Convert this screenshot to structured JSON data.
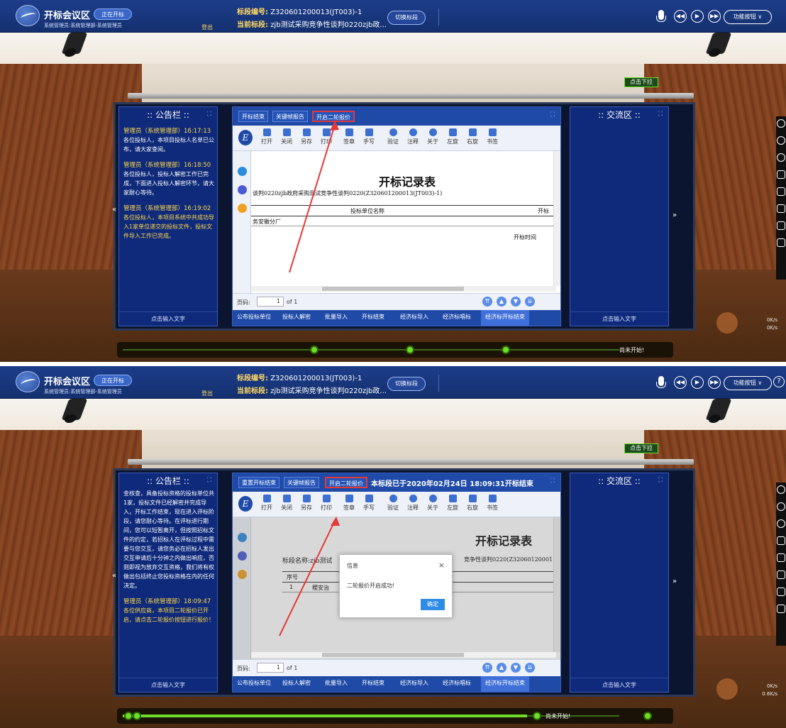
{
  "header": {
    "title": "开标会议区",
    "badge": "正在开标",
    "user": "系统管理员:系统管理部-系统管理员",
    "logout": "登出",
    "bid_no_label": "标段编号:",
    "bid_no": "Z320601200013(JT003)-1",
    "current_label": "当前标段:",
    "current_value": "zjb测试采购竞争性谈判0220zjb政...",
    "switch_btn": "切换标段",
    "prev": "◀◀",
    "play": "▶",
    "next": "▶▶",
    "func_btn": "功能按钮 ∨",
    "help": "?"
  },
  "stage": {
    "drop_btn": "点击下拉",
    "side_left": "«",
    "side_right": "»"
  },
  "left_panel": {
    "title": ":: 公告栏 ::",
    "expand": "⛶",
    "input_hint": "点击输入文字"
  },
  "right_panel": {
    "title": ":: 交流区 ::",
    "expand": "⛶",
    "input_hint": "点击输入文字"
  },
  "shot1": {
    "tabs": [
      "开标结束",
      "关键帧报告",
      "开启二轮报价"
    ],
    "notices": [
      {
        "head": "管理员（系统管理部）16:17:13",
        "body": "各位投标人，本项目投标人名单已公布，请大家查阅。"
      },
      {
        "head": "管理员（系统管理部）16:18:50",
        "body": "各位投标人，投标人解密工作已完成，下面进入投标人解密环节，请大家耐心等待。"
      },
      {
        "head": "管理员（系统管理部）16:19:02",
        "body": "各位投标人，本项目系统中共成功导入1家单位递交的投标文件，投标文件导入工作已完成。"
      }
    ],
    "doc": {
      "title": "开标记录表",
      "line": "谈判0220zjb政府采购测试竞争性谈判0220(Z320601200013(JT003)-1)",
      "col_name": "投标单位名称",
      "col_right": "开标",
      "row_name": "务安徽分厂",
      "row_right": "开标时间"
    },
    "progress": {
      "status": "尚未开始!",
      "fill_fraction": 0.0
    }
  },
  "shot2": {
    "tabs": [
      "重置开标结束",
      "关键帧报告",
      "开启二轮报价"
    ],
    "notice_banner": "本标段已于2020年02月24日 18:09:31开标结束",
    "notices": [
      {
        "head": "",
        "body": "金核查，具备投标资格的投标单位共1家，投标文件已经解密并完成导入，开标工作结束，现在进入评标阶段，请您耐心等待。在评标进行期间，您可以短暂离开，但按照招标文件的约定，若招标人在评标过程中需要与您交互，请您务必在招标人发出交互申请后十分钟之内做出响应，否则即视为放弃交互资格，我们将有权做出包括终止您投标资格在内的任何决定。"
      },
      {
        "head": "管理员（系统管理部）18:09:47",
        "body": "各位供应商，本项目二轮报价已开启，请点击二轮报价按钮进行报价！"
      }
    ],
    "doc": {
      "title": "开标记录表",
      "line_left": "标段名称:zjb测试",
      "line_right": "竞争性谈判0220(Z32060120001",
      "col_no": "序号",
      "row_no": "1",
      "row_name": "稷安治"
    },
    "modal": {
      "title": "信息",
      "close": "×",
      "message": "二轮报价开启成功!",
      "ok": "确定"
    },
    "progress": {
      "status": "尚未开始!",
      "fill_fraction": 0.75
    }
  },
  "toolbar": {
    "items": [
      "打开",
      "关闭",
      "另存",
      "打印",
      "签章",
      "手写",
      "验证",
      "注释",
      "关于",
      "左旋",
      "右旋",
      "书签"
    ]
  },
  "pager": {
    "label": "页码:",
    "value": "1",
    "of": "of 1"
  },
  "bottom_bar": {
    "items": [
      "公布投标单位",
      "投标人解密",
      "批量导入",
      "开标结束",
      "经济标导入",
      "经济标唱标",
      "经济标开标结束"
    ]
  },
  "speed": {
    "up": "0K/s",
    "down": "0K/s",
    "down2": "0.6K/s"
  },
  "colors": {
    "header": "#1d3d8a",
    "panel": "#0f2a7a",
    "highlight": "#e53838",
    "progress": "#6fdc2c",
    "notice_head": "#ffd84a"
  }
}
